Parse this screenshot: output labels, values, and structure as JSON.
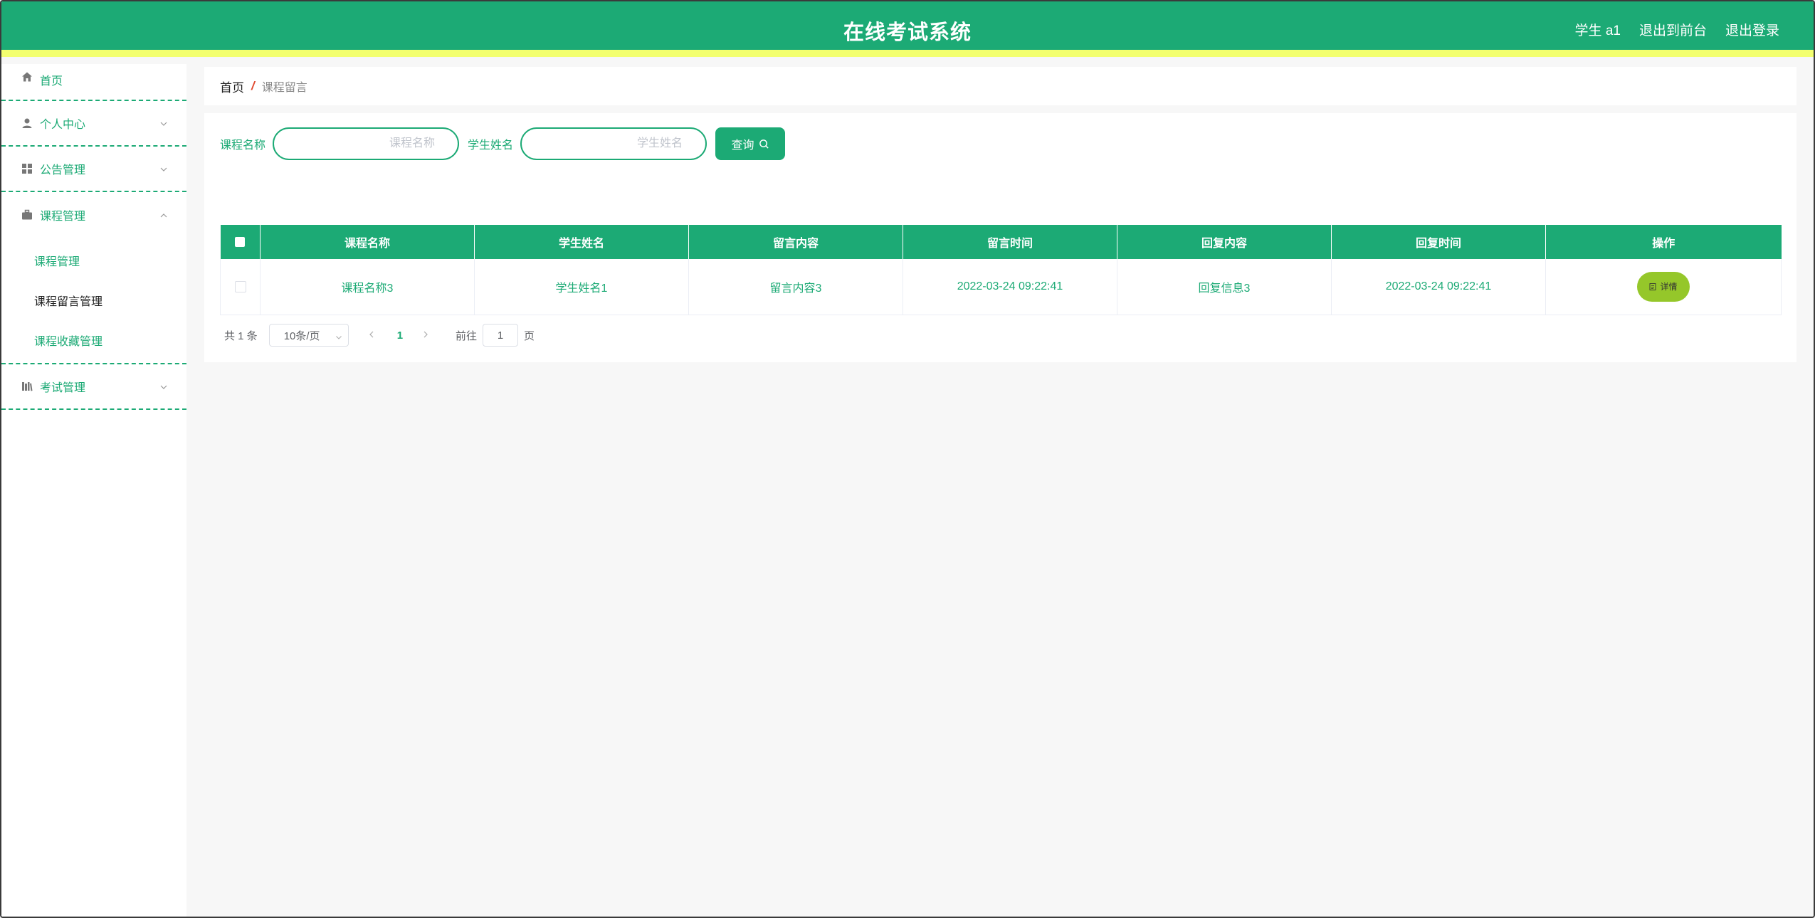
{
  "header": {
    "title": "在线考试系统",
    "user_label": "学生 a1",
    "front_link": "退出到前台",
    "logout_link": "退出登录"
  },
  "sidebar": {
    "items": [
      {
        "label": "首页",
        "icon": "home-icon"
      },
      {
        "label": "个人中心",
        "icon": "user-icon"
      },
      {
        "label": "公告管理",
        "icon": "grid-icon"
      },
      {
        "label": "课程管理",
        "icon": "briefcase-icon",
        "expanded": true,
        "children": [
          "课程管理",
          "课程留言管理",
          "课程收藏管理"
        ]
      },
      {
        "label": "考试管理",
        "icon": "library-icon"
      }
    ],
    "active_child": "课程留言管理"
  },
  "breadcrumb": {
    "home": "首页",
    "separator": "/",
    "current": "课程留言"
  },
  "search": {
    "course_label": "课程名称",
    "course_placeholder": "课程名称",
    "course_value": "",
    "student_label": "学生姓名",
    "student_placeholder": "学生姓名",
    "student_value": "",
    "query_button": "查询"
  },
  "table": {
    "columns": [
      "课程名称",
      "学生姓名",
      "留言内容",
      "留言时间",
      "回复内容",
      "回复时间",
      "操作"
    ],
    "rows": [
      {
        "course": "课程名称3",
        "student": "学生姓名1",
        "message": "留言内容3",
        "message_time": "2022-03-24 09:22:41",
        "reply": "回复信息3",
        "reply_time": "2022-03-24 09:22:41",
        "action": "详情"
      }
    ]
  },
  "pagination": {
    "total": "共 1 条",
    "page_size": "10条/页",
    "current_page": "1",
    "goto_label": "前往",
    "goto_value": "1",
    "page_suffix": "页"
  },
  "colors": {
    "primary": "#1caa75",
    "accent_stripe": "#f3ff6f",
    "detail_button": "#95c72a",
    "breadcrumb_separator": "#e0482e"
  }
}
